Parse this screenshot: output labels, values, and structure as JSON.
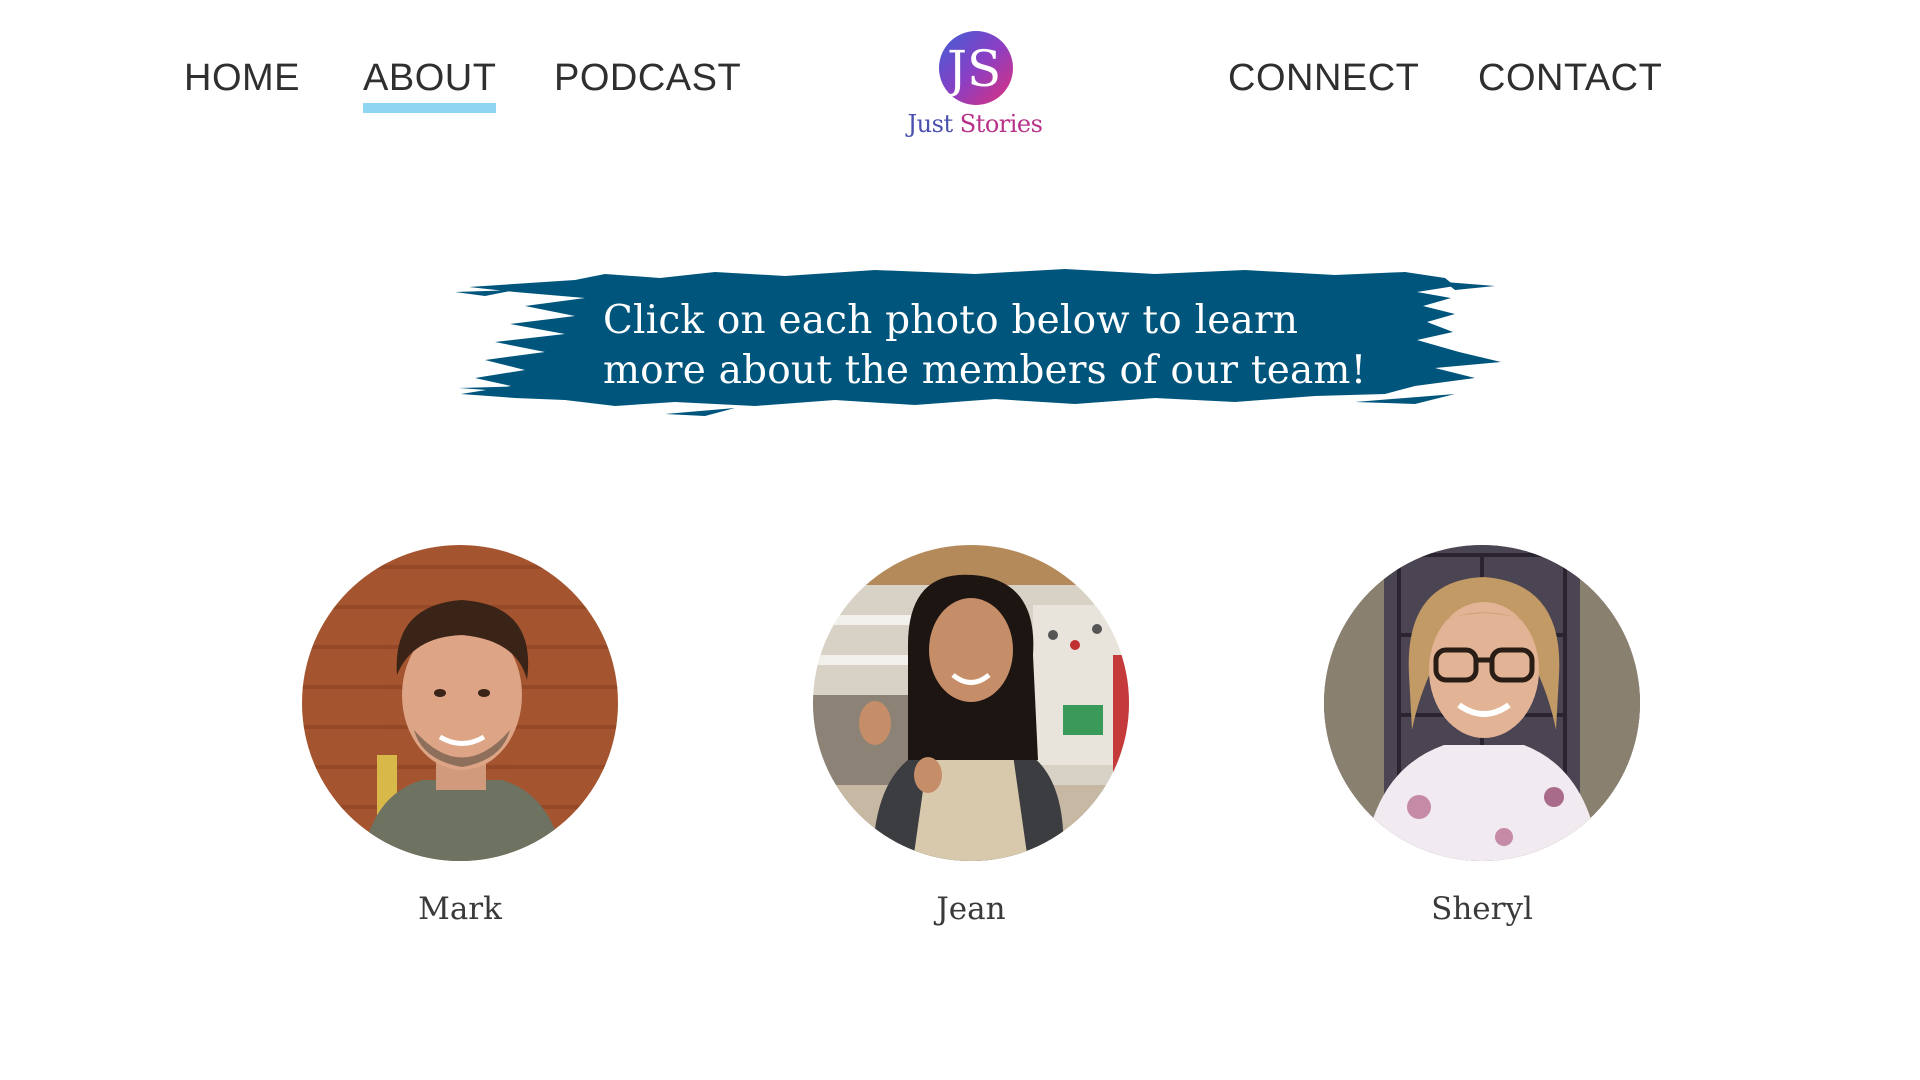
{
  "nav": {
    "items": [
      {
        "label": "HOME"
      },
      {
        "label": "ABOUT",
        "active": true
      },
      {
        "label": "PODCAST"
      },
      {
        "label": "CONNECT"
      },
      {
        "label": "CONTACT"
      }
    ],
    "active_underline_color": "#8fd6f3"
  },
  "logo": {
    "monogram": "JS",
    "word1": "Just",
    "word2": "Stories",
    "colors": [
      "#3f5fd6",
      "#8a3fc4",
      "#e0307a"
    ]
  },
  "banner": {
    "line1": "Click on each photo below to learn",
    "line2": "more about the members of our team!",
    "color": "#00557c"
  },
  "team": [
    {
      "name": "Mark",
      "photo": "mark-portrait"
    },
    {
      "name": "Jean",
      "photo": "jean-portrait"
    },
    {
      "name": "Sheryl",
      "photo": "sheryl-portrait"
    }
  ]
}
